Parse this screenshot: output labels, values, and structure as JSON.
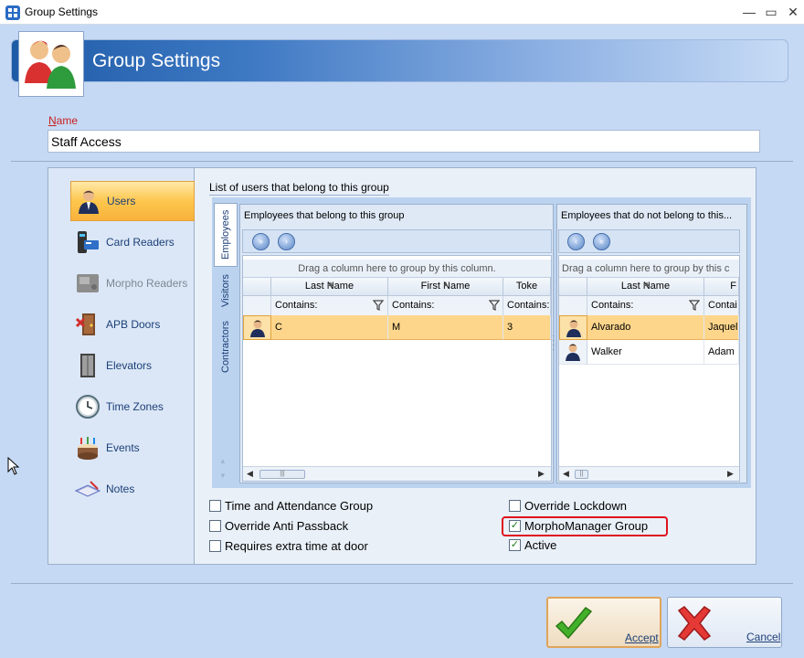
{
  "window": {
    "title": "Group Settings",
    "controls": {
      "minimize": "—",
      "maximize": "▭",
      "close": "✕"
    }
  },
  "header": {
    "title": "Group Settings",
    "icon": "users-group-icon"
  },
  "name_field": {
    "label_first": "N",
    "label_rest": "ame",
    "value": "Staff Access"
  },
  "nav": {
    "items": [
      {
        "label": "Users",
        "icon": "user-icon",
        "active": true
      },
      {
        "label": "Card Readers",
        "icon": "card-reader-icon"
      },
      {
        "label": "Morpho Readers",
        "icon": "morpho-reader-icon",
        "disabled": true
      },
      {
        "label": "APB Doors",
        "icon": "apb-door-icon"
      },
      {
        "label": "Elevators",
        "icon": "elevator-icon"
      },
      {
        "label": "Time Zones",
        "icon": "clock-icon"
      },
      {
        "label": "Events",
        "icon": "cake-icon"
      },
      {
        "label": "Notes",
        "icon": "notes-icon"
      }
    ]
  },
  "content": {
    "list_title": "List of users that belong to this group",
    "tabs": [
      {
        "label": "Employees",
        "active": true
      },
      {
        "label": "Visitors"
      },
      {
        "label": "Contractors"
      }
    ],
    "left_grid": {
      "caption": "Employees that belong to this group",
      "group_hint": "Drag a column here to group by this column.",
      "columns": [
        "Last Name",
        "First Name",
        "Toke"
      ],
      "filters": [
        "Contains:",
        "Contains:",
        "Contains:"
      ],
      "rows": [
        {
          "cells": [
            "C",
            "M",
            "3"
          ],
          "selected": true
        }
      ]
    },
    "right_grid": {
      "caption": "Employees that do not belong to this...",
      "group_hint": "Drag a column here to group by this c",
      "columns": [
        "Last Name",
        "F"
      ],
      "filters": [
        "Contains:",
        "Contai"
      ],
      "rows": [
        {
          "cells": [
            "Alvarado",
            "Jaqueli"
          ],
          "selected": true
        },
        {
          "cells": [
            "Walker",
            "Adam"
          ],
          "selected": false
        }
      ]
    }
  },
  "options": {
    "time_attendance": {
      "label": "Time and Attendance Group",
      "checked": false
    },
    "override_anti_passback": {
      "label": "Override Anti Passback",
      "checked": false
    },
    "extra_time": {
      "label": "Requires extra time at door",
      "checked": false
    },
    "override_lockdown": {
      "label": "Override Lockdown",
      "checked": false
    },
    "morpho_manager": {
      "label": "MorphoManager Group",
      "checked": true
    },
    "active": {
      "label": "Active",
      "checked": true
    }
  },
  "buttons": {
    "accept": {
      "first": "A",
      "rest": "ccept"
    },
    "cancel": {
      "first": "C",
      "rest": "ancel"
    }
  },
  "colors": {
    "accent": "#1e5ba6",
    "selection": "#fdd68c",
    "highlight": "#e0121f"
  }
}
